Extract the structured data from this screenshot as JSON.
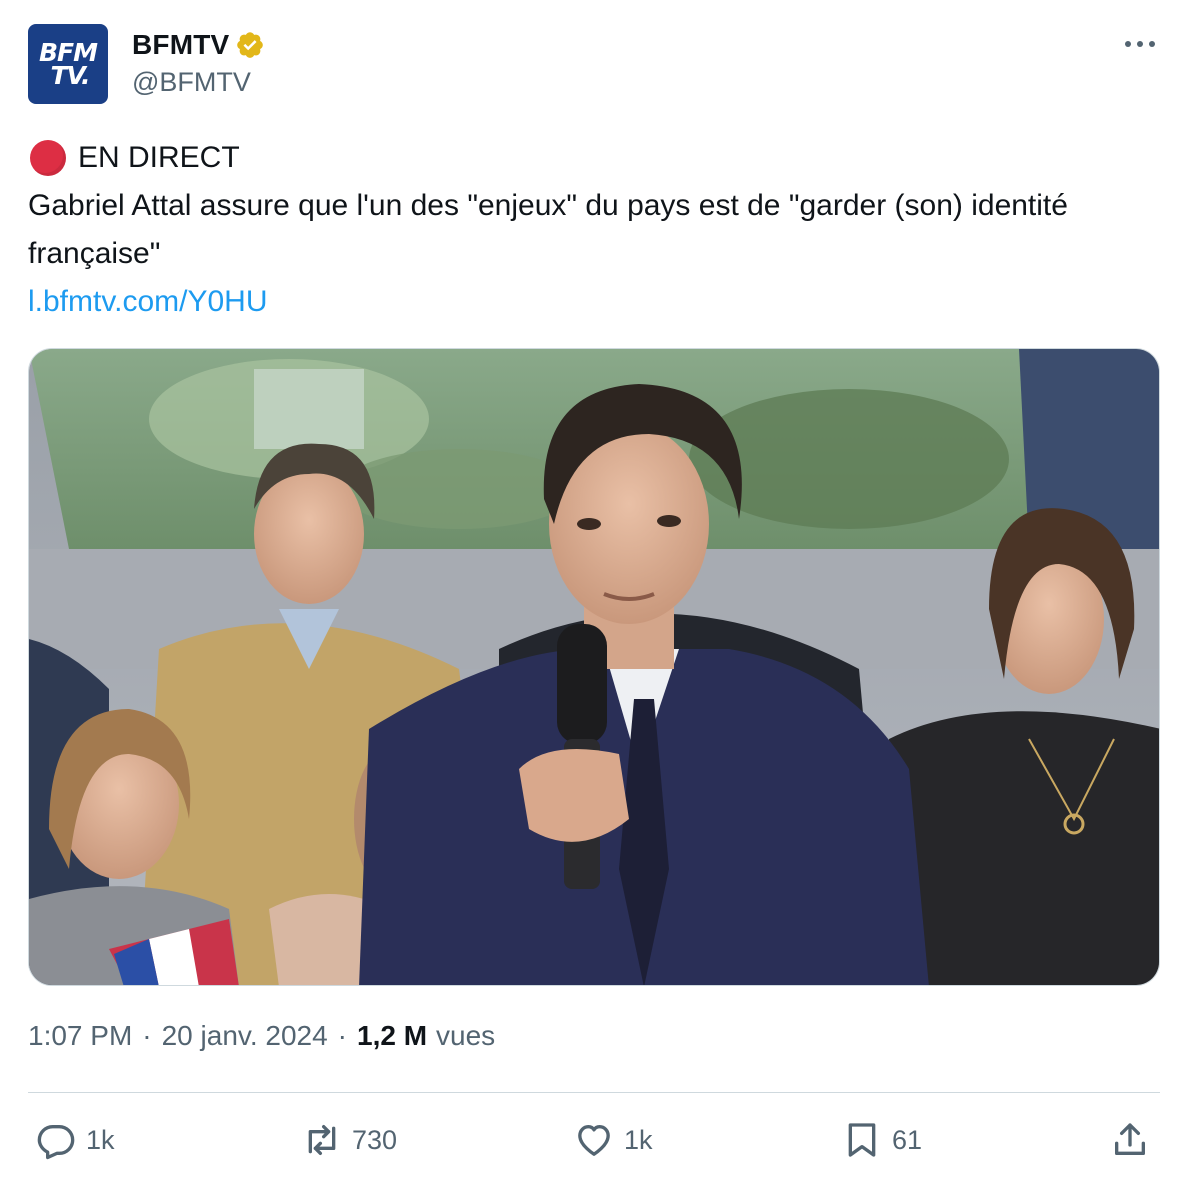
{
  "account": {
    "avatar_line1": "BFM",
    "avatar_line2": "TV.",
    "display_name": "BFMTV",
    "handle": "@BFMTV"
  },
  "tweet": {
    "live_label": "EN DIRECT",
    "body": "Gabriel Attal assure que l'un des \"enjeux\" du pays est de \"garder (son) identité française\"",
    "link": "l.bfmtv.com/Y0HU"
  },
  "meta": {
    "time": "1:07 PM",
    "date": "20 janv. 2024",
    "views_count": "1,2 M",
    "views_label": "vues"
  },
  "actions": {
    "replies": "1k",
    "reposts": "730",
    "likes": "1k",
    "bookmarks": "61"
  },
  "icons": {
    "verified": "verified-badge-icon",
    "more": "more-icon",
    "reply": "reply-icon",
    "repost": "repost-icon",
    "like": "heart-icon",
    "bookmark": "bookmark-icon",
    "share": "share-icon"
  },
  "colors": {
    "brand_blue": "#1a3f86",
    "link": "#1d9bf0",
    "verified_gold": "#e2b719",
    "live_red": "#dd2e44",
    "muted_text": "#536471"
  }
}
